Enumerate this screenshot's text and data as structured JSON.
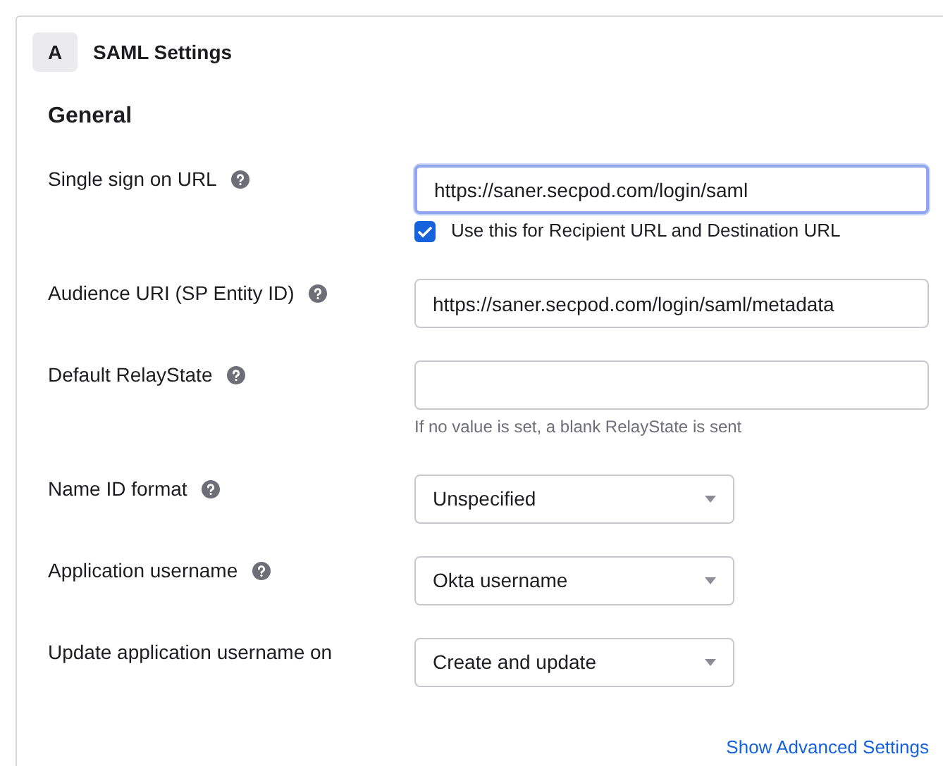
{
  "section": {
    "badge": "A",
    "title": "SAML Settings"
  },
  "heading": "General",
  "fields": [
    {
      "kind": "text",
      "label": "Single sign on URL",
      "help": true,
      "value": "https://saner.secpod.com/login/saml",
      "focused": true,
      "checkbox": {
        "label": "Use this for Recipient URL and Destination URL",
        "checked": true
      }
    },
    {
      "kind": "text",
      "label": "Audience URI (SP Entity ID)",
      "help": true,
      "value": "https://saner.secpod.com/login/saml/metadata",
      "focused": false
    },
    {
      "kind": "text",
      "label": "Default RelayState",
      "help": true,
      "focused": false,
      "hint": "If no value is set, a blank RelayState is sent"
    },
    {
      "kind": "select",
      "label": "Name ID format",
      "help": true,
      "value": "Unspecified"
    },
    {
      "kind": "select",
      "label": "Application username",
      "help": true,
      "value": "Okta username"
    },
    {
      "kind": "select",
      "label": "Update application username on",
      "help": false,
      "value": "Create and update"
    }
  ],
  "link": "Show Advanced Settings"
}
